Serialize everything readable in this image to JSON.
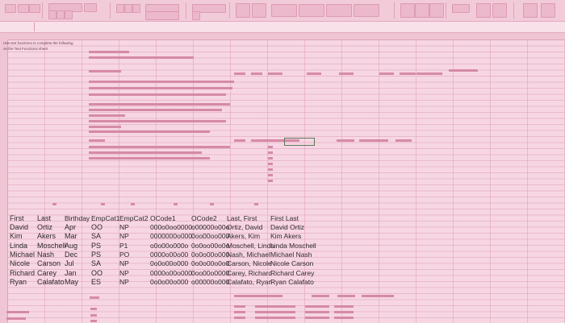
{
  "formula_bar": {
    "name_box": "",
    "formula": ""
  },
  "instructions": [
    "Use text functions to complete the following",
    "on the Text Functions sheet"
  ],
  "table": {
    "headers": [
      "First",
      "Last",
      "Birthday",
      "EmpCat1",
      "EmpCat2",
      "OCode1",
      "OCode2",
      "Last, First",
      "First Last"
    ],
    "rows": [
      [
        "David",
        "Ortiz",
        "Apr",
        "OO",
        "NP",
        "000o0oo0000",
        "o00000o00o",
        "Ortiz, David",
        "David Ortiz"
      ],
      [
        "Kim",
        "Akers",
        "Mar",
        "SA",
        "NP",
        "0000000o000",
        "0oo00oo000",
        "Akers, Kim",
        "Kim Akers"
      ],
      [
        "Linda",
        "Moschell",
        "Aug",
        "PS",
        "P1",
        "o0o00o000o",
        "0o0oo00o0o",
        "Moschell, Linda",
        "Linda Moschell"
      ],
      [
        "Michael",
        "Nash",
        "Dec",
        "PS",
        "PO",
        "0000o00o00",
        "0o0o00o000",
        "Nash, Michael",
        "Michael Nash"
      ],
      [
        "Nicole",
        "Carson",
        "Jul",
        "SA",
        "NP",
        "0o0o00o000",
        "0o0o00o0o0",
        "Carson, Nicole",
        "Nicole Carson"
      ],
      [
        "Richard",
        "Carey",
        "Jan",
        "OO",
        "NP",
        "0000o00o000",
        "0oo00o0000",
        "Carey, Richard",
        "Richard Carey"
      ],
      [
        "Ryan",
        "Calafato",
        "May",
        "ES",
        "NP",
        "0o0o00o000",
        "o00000o000",
        "Calafato, Ryan",
        "Ryan Calafato"
      ]
    ]
  }
}
